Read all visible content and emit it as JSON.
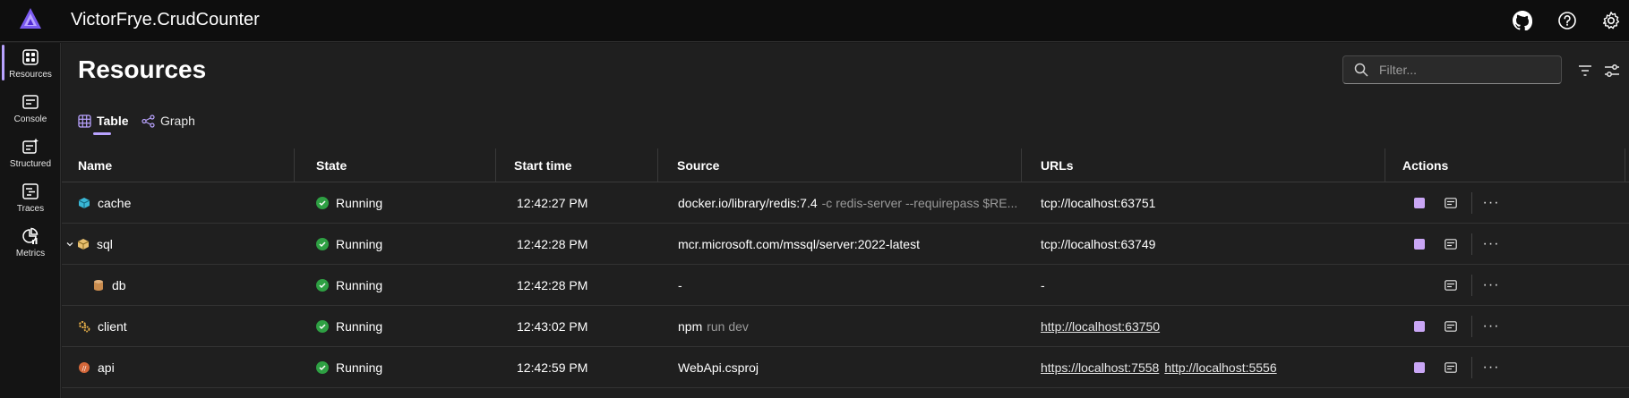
{
  "app": {
    "title": "VictorFrye.CrudCounter"
  },
  "topbar": {
    "icons": [
      "github-icon",
      "help-icon",
      "settings-icon"
    ]
  },
  "sidebar": {
    "items": [
      {
        "label": "Resources",
        "icon": "resources-icon",
        "active": true
      },
      {
        "label": "Console",
        "icon": "console-icon"
      },
      {
        "label": "Structured",
        "icon": "structured-icon"
      },
      {
        "label": "Traces",
        "icon": "traces-icon"
      },
      {
        "label": "Metrics",
        "icon": "metrics-icon"
      }
    ]
  },
  "page": {
    "title": "Resources"
  },
  "filter": {
    "placeholder": "Filter..."
  },
  "tabs": [
    {
      "label": "Table",
      "icon": "table-icon",
      "active": true
    },
    {
      "label": "Graph",
      "icon": "graph-icon"
    }
  ],
  "table": {
    "columns": [
      "Name",
      "State",
      "Start time",
      "Source",
      "URLs",
      "Actions"
    ],
    "rows": [
      {
        "name": "cache",
        "icon": "container-icon",
        "state": "Running",
        "start": "12:42:27 PM",
        "source": "docker.io/library/redis:7.4",
        "source_args": "-c redis-server --requirepass $RE...",
        "urls": [
          "tcp://localhost:63751"
        ],
        "url_links": false,
        "has_stop": true
      },
      {
        "name": "sql",
        "icon": "container-icon",
        "expandable": true,
        "state": "Running",
        "start": "12:42:28 PM",
        "source": "mcr.microsoft.com/mssql/server:2022-latest",
        "source_args": "",
        "urls": [
          "tcp://localhost:63749"
        ],
        "url_links": false,
        "has_stop": true
      },
      {
        "name": "db",
        "icon": "database-icon",
        "child": true,
        "state": "Running",
        "start": "12:42:28 PM",
        "source": "-",
        "source_args": "",
        "urls": [
          "-"
        ],
        "url_links": false,
        "has_stop": false
      },
      {
        "name": "client",
        "icon": "executable-icon",
        "state": "Running",
        "start": "12:43:02 PM",
        "source": "npm",
        "source_args": "run dev",
        "urls": [
          "http://localhost:63750"
        ],
        "url_links": true,
        "has_stop": true
      },
      {
        "name": "api",
        "icon": "project-icon",
        "state": "Running",
        "start": "12:42:59 PM",
        "source": "WebApi.csproj",
        "source_args": "",
        "urls": [
          "https://localhost:7558",
          "http://localhost:5556"
        ],
        "url_links": true,
        "has_stop": true
      }
    ]
  },
  "colors": {
    "accent": "#b9a3ff",
    "running": "#2ea043",
    "stop": "#c9a6f5"
  }
}
